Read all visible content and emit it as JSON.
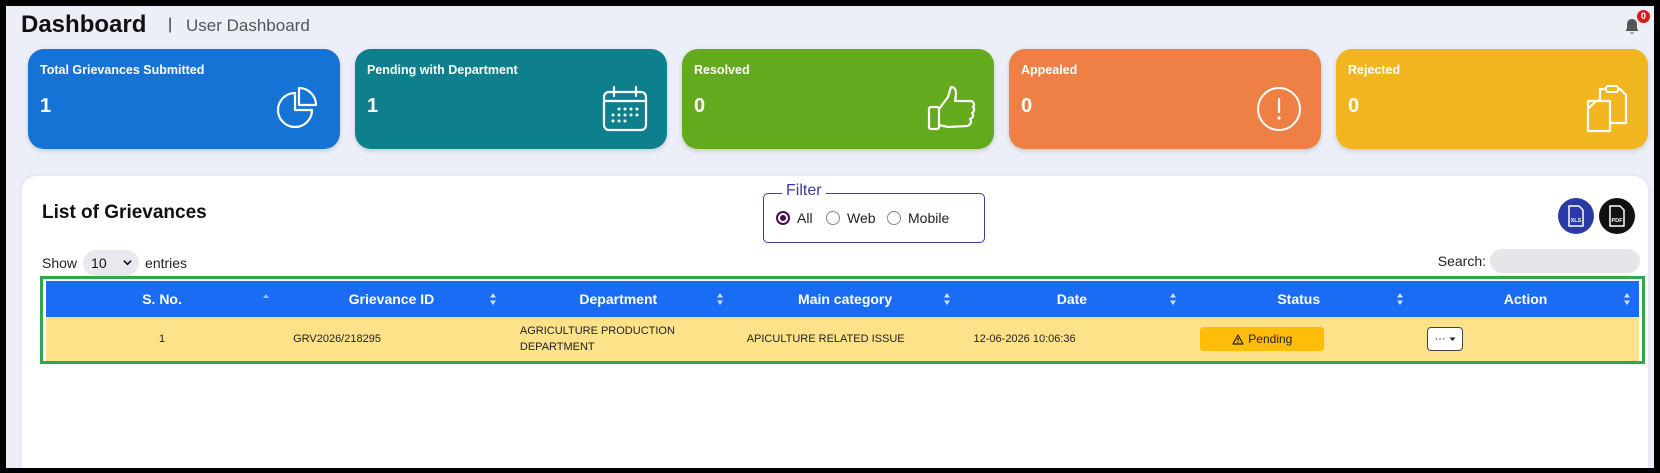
{
  "header": {
    "title": "Dashboard",
    "separator": "|",
    "subtitle": "User Dashboard",
    "notification_count": "0"
  },
  "cards": [
    {
      "label": "Total Grievances Submitted",
      "count": "1",
      "color": "#1673d6",
      "icon": "pie-chart-icon"
    },
    {
      "label": "Pending with Department",
      "count": "1",
      "color": "#0e7f8c",
      "icon": "calendar-icon"
    },
    {
      "label": "Resolved",
      "count": "0",
      "color": "#63aa1d",
      "icon": "thumbs-up-icon"
    },
    {
      "label": "Appealed",
      "count": "0",
      "color": "#ee8045",
      "icon": "exclamation-circle-icon"
    },
    {
      "label": "Rejected",
      "count": "0",
      "color": "#f0b51f",
      "icon": "clipboard-copy-icon"
    }
  ],
  "list": {
    "title": "List of Grievances",
    "filter": {
      "legend": "Filter",
      "options": [
        "All",
        "Web",
        "Mobile"
      ],
      "selected": "All"
    },
    "export": {
      "xls_label": "XLS",
      "pdf_label": "PDF"
    },
    "show_label": "Show",
    "entries_value": "10",
    "entries_label": "entries",
    "search_label": "Search:",
    "search_value": ""
  },
  "table": {
    "columns": [
      "S. No.",
      "Grievance ID",
      "Department",
      "Main category",
      "Date",
      "Status",
      "Action"
    ],
    "rows": [
      {
        "sno": "1",
        "grievance_id": "GRV2026/218295",
        "department": "AGRICULTURE PRODUCTION DEPARTMENT",
        "category": "APICULTURE RELATED ISSUE",
        "date": "12-06-2026 10:06:36",
        "status": "Pending",
        "action": "···"
      }
    ]
  },
  "colors": {
    "header_blue": "#1a6cf5",
    "row_yellow": "#fde28a",
    "pending_badge": "#ffbd0a",
    "highlight_border": "#2ea84e"
  }
}
